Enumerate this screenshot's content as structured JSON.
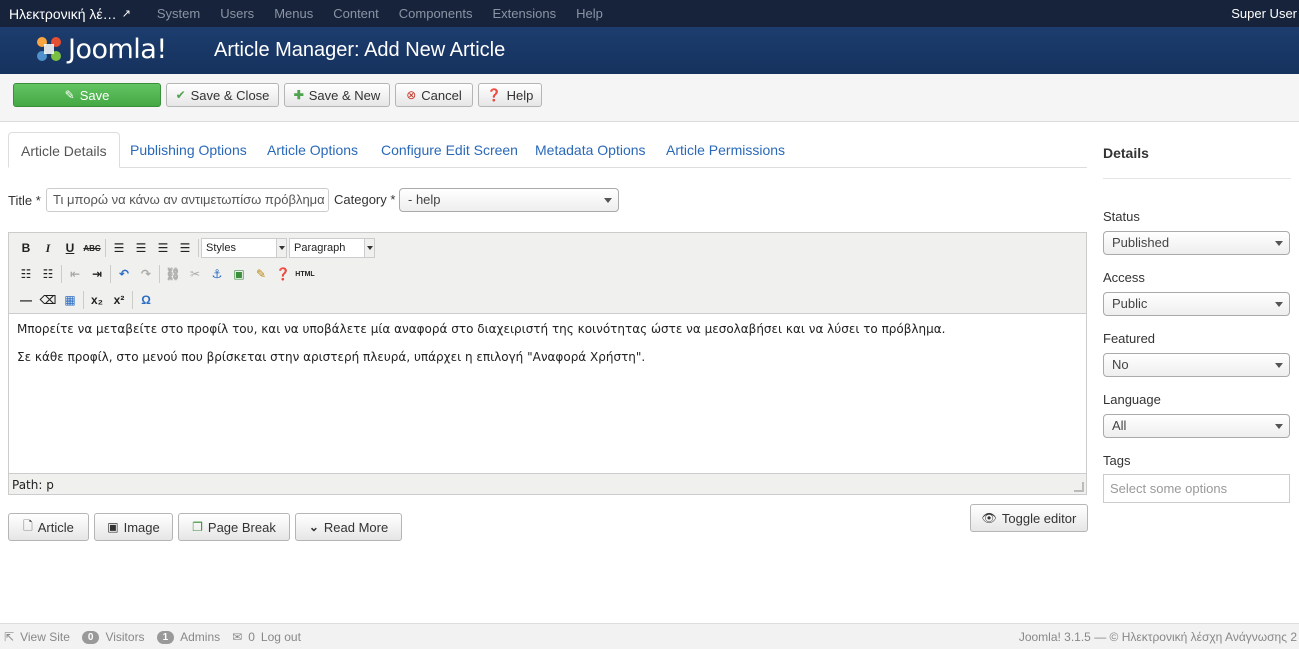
{
  "topbar": {
    "site_name": "Ηλεκτρονική λέ…",
    "menu": [
      "System",
      "Users",
      "Menus",
      "Content",
      "Components",
      "Extensions",
      "Help"
    ],
    "user": "Super User"
  },
  "header": {
    "brand": "Joomla!",
    "title": "Article Manager: Add New Article"
  },
  "toolbar": {
    "save": "Save",
    "save_close": "Save & Close",
    "save_new": "Save & New",
    "cancel": "Cancel",
    "help": "Help"
  },
  "tabs": [
    "Article Details",
    "Publishing Options",
    "Article Options",
    "Configure Edit Screen",
    "Metadata Options",
    "Article Permissions"
  ],
  "form": {
    "title_label": "Title *",
    "title_value": "Τι μπορώ να κάνω αν αντιμετωπίσω πρόβλημα με",
    "category_label": "Category *",
    "category_value": "- help"
  },
  "editor": {
    "styles": "Styles",
    "format": "Paragraph",
    "paragraphs": [
      "Μπορείτε να μεταβείτε στο προφίλ του, και να υποβάλετε μία αναφορά στο διαχειριστή της κοινότητας ώστε να μεσολαβήσει και να λύσει το πρόβλημα.",
      "Σε κάθε προφίλ, στο μενού που βρίσκεται στην αριστερή πλευρά, υπάρχει η επιλογή \"Αναφορά Χρήστη\"."
    ],
    "path": "Path: p"
  },
  "editor_buttons": {
    "article": "Article",
    "image": "Image",
    "page_break": "Page Break",
    "read_more": "Read More",
    "toggle": "Toggle editor"
  },
  "details": {
    "heading": "Details",
    "status_label": "Status",
    "status_value": "Published",
    "access_label": "Access",
    "access_value": "Public",
    "featured_label": "Featured",
    "featured_value": "No",
    "language_label": "Language",
    "language_value": "All",
    "tags_label": "Tags",
    "tags_placeholder": "Select some options"
  },
  "footer": {
    "view_site": "View Site",
    "visitors_count": "0",
    "visitors": "Visitors",
    "admins_count": "1",
    "admins": "Admins",
    "messages_count": "0",
    "logout": "Log out",
    "version": "Joomla! 3.1.5 — © Ηλεκτρονική λέσχη Ανάγνωσης 2"
  },
  "colors": {
    "topbar": "#17233a",
    "header": "#1a3867",
    "save": "#51b351",
    "link": "#2a69b8"
  }
}
